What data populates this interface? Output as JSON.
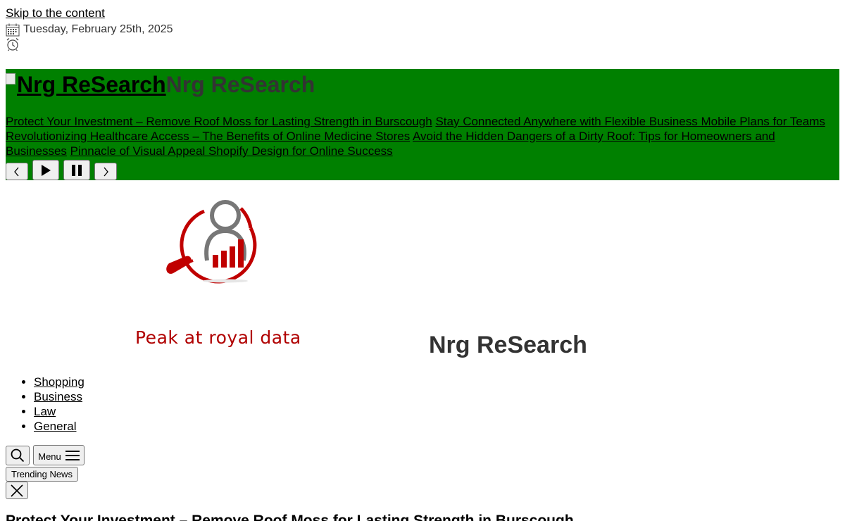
{
  "skip_link": "Skip to the content",
  "date": "Tuesday, February 25th, 2025",
  "icons": {
    "calendar": "calendar-icon",
    "clock": "alarm-clock-icon",
    "prev": "chevron-left-icon",
    "play": "play-icon",
    "pause": "pause-icon",
    "next": "chevron-right-icon",
    "search": "search-icon",
    "menu": "hamburger-menu-icon",
    "close": "close-icon"
  },
  "colors": {
    "ticker_background": "#008000",
    "tagline": "#b00000",
    "title": "#333333"
  },
  "ticker": {
    "logo_link_text": "Nrg ReSearch",
    "site_title": "Nrg ReSearch",
    "items": [
      "Protect Your Investment – Remove Roof Moss for Lasting Strength in Burscough",
      "Stay Connected Anywhere with Flexible Business Mobile Plans for Teams",
      "Revolutionizing Healthcare Access – The Benefits of Online Medicine Stores",
      "Avoid the Hidden Dangers of a Dirty Roof: Tips for Homeowners and Businesses",
      "Pinnacle of Visual Appeal Shopify Design for Online Success"
    ]
  },
  "header": {
    "tagline": "Peak at royal data",
    "site_title": "Nrg ReSearch"
  },
  "nav": {
    "items": [
      "Shopping",
      "Business",
      "Law",
      "General"
    ]
  },
  "buttons": {
    "menu_label": "Menu",
    "trending": "Trending News"
  },
  "article": {
    "heading": "Protect Your Investment – Remove Roof Moss for Lasting Strength in Burscough"
  }
}
